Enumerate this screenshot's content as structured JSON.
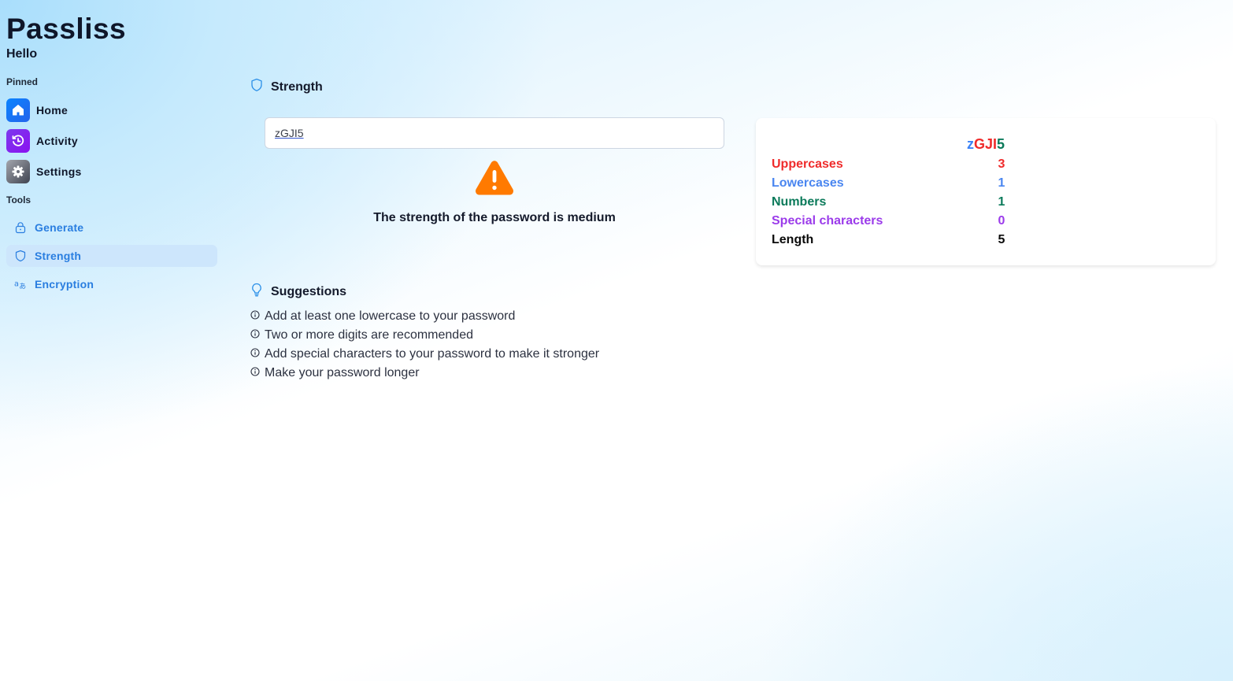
{
  "app": {
    "title": "Passliss",
    "subtitle": "Hello"
  },
  "sidebar": {
    "pinned_label": "Pinned",
    "pinned": [
      {
        "label": "Home",
        "icon": "home-icon",
        "color_from": "#0a84ff",
        "color_to": "#2563eb"
      },
      {
        "label": "Activity",
        "icon": "history-icon",
        "color_from": "#7c3aed",
        "color_to": "#8b11f0"
      },
      {
        "label": "Settings",
        "icon": "gear-icon",
        "color_from": "#9ca3af",
        "color_to": "#4b5563"
      }
    ],
    "tools_label": "Tools",
    "tools": [
      {
        "label": "Generate",
        "icon": "lock-icon",
        "active": false
      },
      {
        "label": "Strength",
        "icon": "shield-icon",
        "active": true
      },
      {
        "label": "Encryption",
        "icon": "translate-icon",
        "active": false
      }
    ]
  },
  "strength": {
    "heading": "Strength",
    "password_value": "zGJI5",
    "status_icon": "warning-icon",
    "status_color": "#ff7a00",
    "message": "The strength of the password is medium"
  },
  "details": {
    "password_chars": [
      {
        "char": "z",
        "color": "#3b82f6"
      },
      {
        "char": "G",
        "color": "#ef2b2b"
      },
      {
        "char": "J",
        "color": "#ef2b2b"
      },
      {
        "char": "I",
        "color": "#ef2b2b"
      },
      {
        "char": "5",
        "color": "#0b7a5a"
      }
    ],
    "stats": [
      {
        "label": "Uppercases",
        "value": "3",
        "color": "#ef2b2b"
      },
      {
        "label": "Lowercases",
        "value": "1",
        "color": "#4a86f0"
      },
      {
        "label": "Numbers",
        "value": "1",
        "color": "#0b7a5a"
      },
      {
        "label": "Special characters",
        "value": "0",
        "color": "#9b3bea"
      },
      {
        "label": "Length",
        "value": "5",
        "color": "#0a0a0a"
      }
    ]
  },
  "suggestions": {
    "heading": "Suggestions",
    "items": [
      "Add at least one lowercase to your password",
      "Two or more digits are recommended",
      "Add special characters to your password to make it stronger",
      "Make your password longer"
    ]
  },
  "colors": {
    "accent": "#2a7ee0",
    "active_nav_bg": "#cde6fc"
  }
}
